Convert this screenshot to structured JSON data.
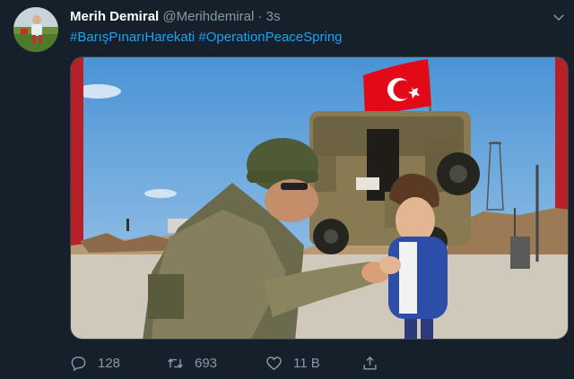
{
  "tweet": {
    "author_name": "Merih Demiral",
    "author_handle": "@Merihdemiral",
    "separator": "·",
    "time": "3s",
    "hashtags": [
      "#BarışPınarıHarekati",
      "#OperationPeaceSpring"
    ]
  },
  "actions": {
    "reply_count": "128",
    "retweet_count": "693",
    "like_count": "11 B",
    "share_label": ""
  },
  "icons": {
    "reply": "reply-icon",
    "retweet": "retweet-icon",
    "like": "heart-icon",
    "share": "share-icon",
    "menu": "chevron-down-icon"
  },
  "colors": {
    "background": "#15202b",
    "link": "#1da1f2",
    "secondary_text": "#8899a6",
    "flag_red": "#e30a17"
  }
}
